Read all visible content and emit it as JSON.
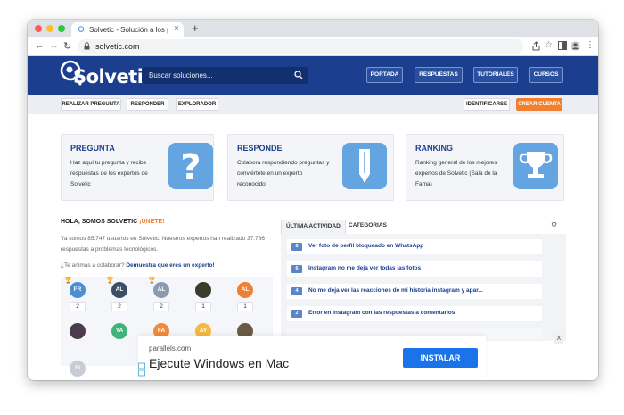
{
  "browser": {
    "tab_title": "Solvetic - Solución a los problemas",
    "url": "solvetic.com",
    "colors": {
      "close": "#ff5f57",
      "minimize": "#febc2e",
      "maximize": "#28c840"
    }
  },
  "header": {
    "logo": "Solvetic",
    "search_placeholder": "Buscar soluciones...",
    "nav": [
      "PORTADA",
      "RESPUESTAS",
      "TUTORIALES",
      "CURSOS"
    ],
    "brand_color": "#1b3e8f"
  },
  "subnav": {
    "left": [
      "REALIZAR PREGUNTA",
      "RESPONDER",
      "EXPLORADOR"
    ],
    "identify": "IDENTIFICARSE",
    "create": "CREAR CUENTA"
  },
  "cards": [
    {
      "title": "PREGUNTA",
      "desc": "Haz aquí tu pregunta y recibe respuestas de los expertos de Solvetic",
      "icon": "question-icon"
    },
    {
      "title": "RESPONDE",
      "desc": "Colabora respondiendo preguntas y conviértete en un experto reconocido",
      "icon": "pencil-icon"
    },
    {
      "title": "RANKING",
      "desc": "Ranking general de los mejores expertos de Solvetic (Sala de la Fama)",
      "icon": "trophy-icon"
    }
  ],
  "community": {
    "hello": "HOLA, SOMOS SOLVETIC ",
    "join": "¡ÚNETE!",
    "stats": "Ya somos 85.747 usuarios en Solvetic. Nuestros expertos han realizado 37.786 respuestas a problemas tecnológicos.",
    "invite_prefix": "¿Te animas a colaborar? ",
    "invite_link": "Demuestra que eres un experto!",
    "users": [
      {
        "initials": "FR",
        "count": "2",
        "color": "#4a8fd6"
      },
      {
        "initials": "AL",
        "count": "2",
        "color": "#3a4f66"
      },
      {
        "initials": "AL",
        "count": "2",
        "color": "#8a9bb0"
      },
      {
        "initials": "",
        "count": "1",
        "color": "#3b3b2c"
      },
      {
        "initials": "AL",
        "count": "1",
        "color": "#f0802f"
      },
      {
        "initials": "",
        "count": "",
        "color": "#4b3b4d"
      },
      {
        "initials": "YA",
        "count": "",
        "color": "#3fb37b"
      },
      {
        "initials": "FA",
        "count": "",
        "color": "#f28a3c"
      },
      {
        "initials": "AY",
        "count": "",
        "color": "#f5b942"
      },
      {
        "initials": "",
        "count": "",
        "color": "#6b5a45"
      },
      {
        "initials": "FI",
        "count": "",
        "color": "#c8ccd4"
      },
      {
        "initials": "",
        "count": "",
        "color": "#ffffff"
      }
    ]
  },
  "activity": {
    "tabs": [
      "ÚLTIMA ACTIVIDAD",
      "CATEGORIAS"
    ],
    "items": [
      {
        "n": "8",
        "text": "Ver foto de perfil bloqueado en WhatsApp"
      },
      {
        "n": "6",
        "text": "Instagram no me deja ver todas las fotos"
      },
      {
        "n": "4",
        "text": "No me deja ver las reacciones de mi historia instagram y apar..."
      },
      {
        "n": "2",
        "text": "Error en instagram con las respuestas a comentarios"
      }
    ]
  },
  "ad": {
    "domain": "parallels.com",
    "headline": "Ejecute Windows en Mac",
    "cta": "INSTALAR",
    "close": "X"
  }
}
